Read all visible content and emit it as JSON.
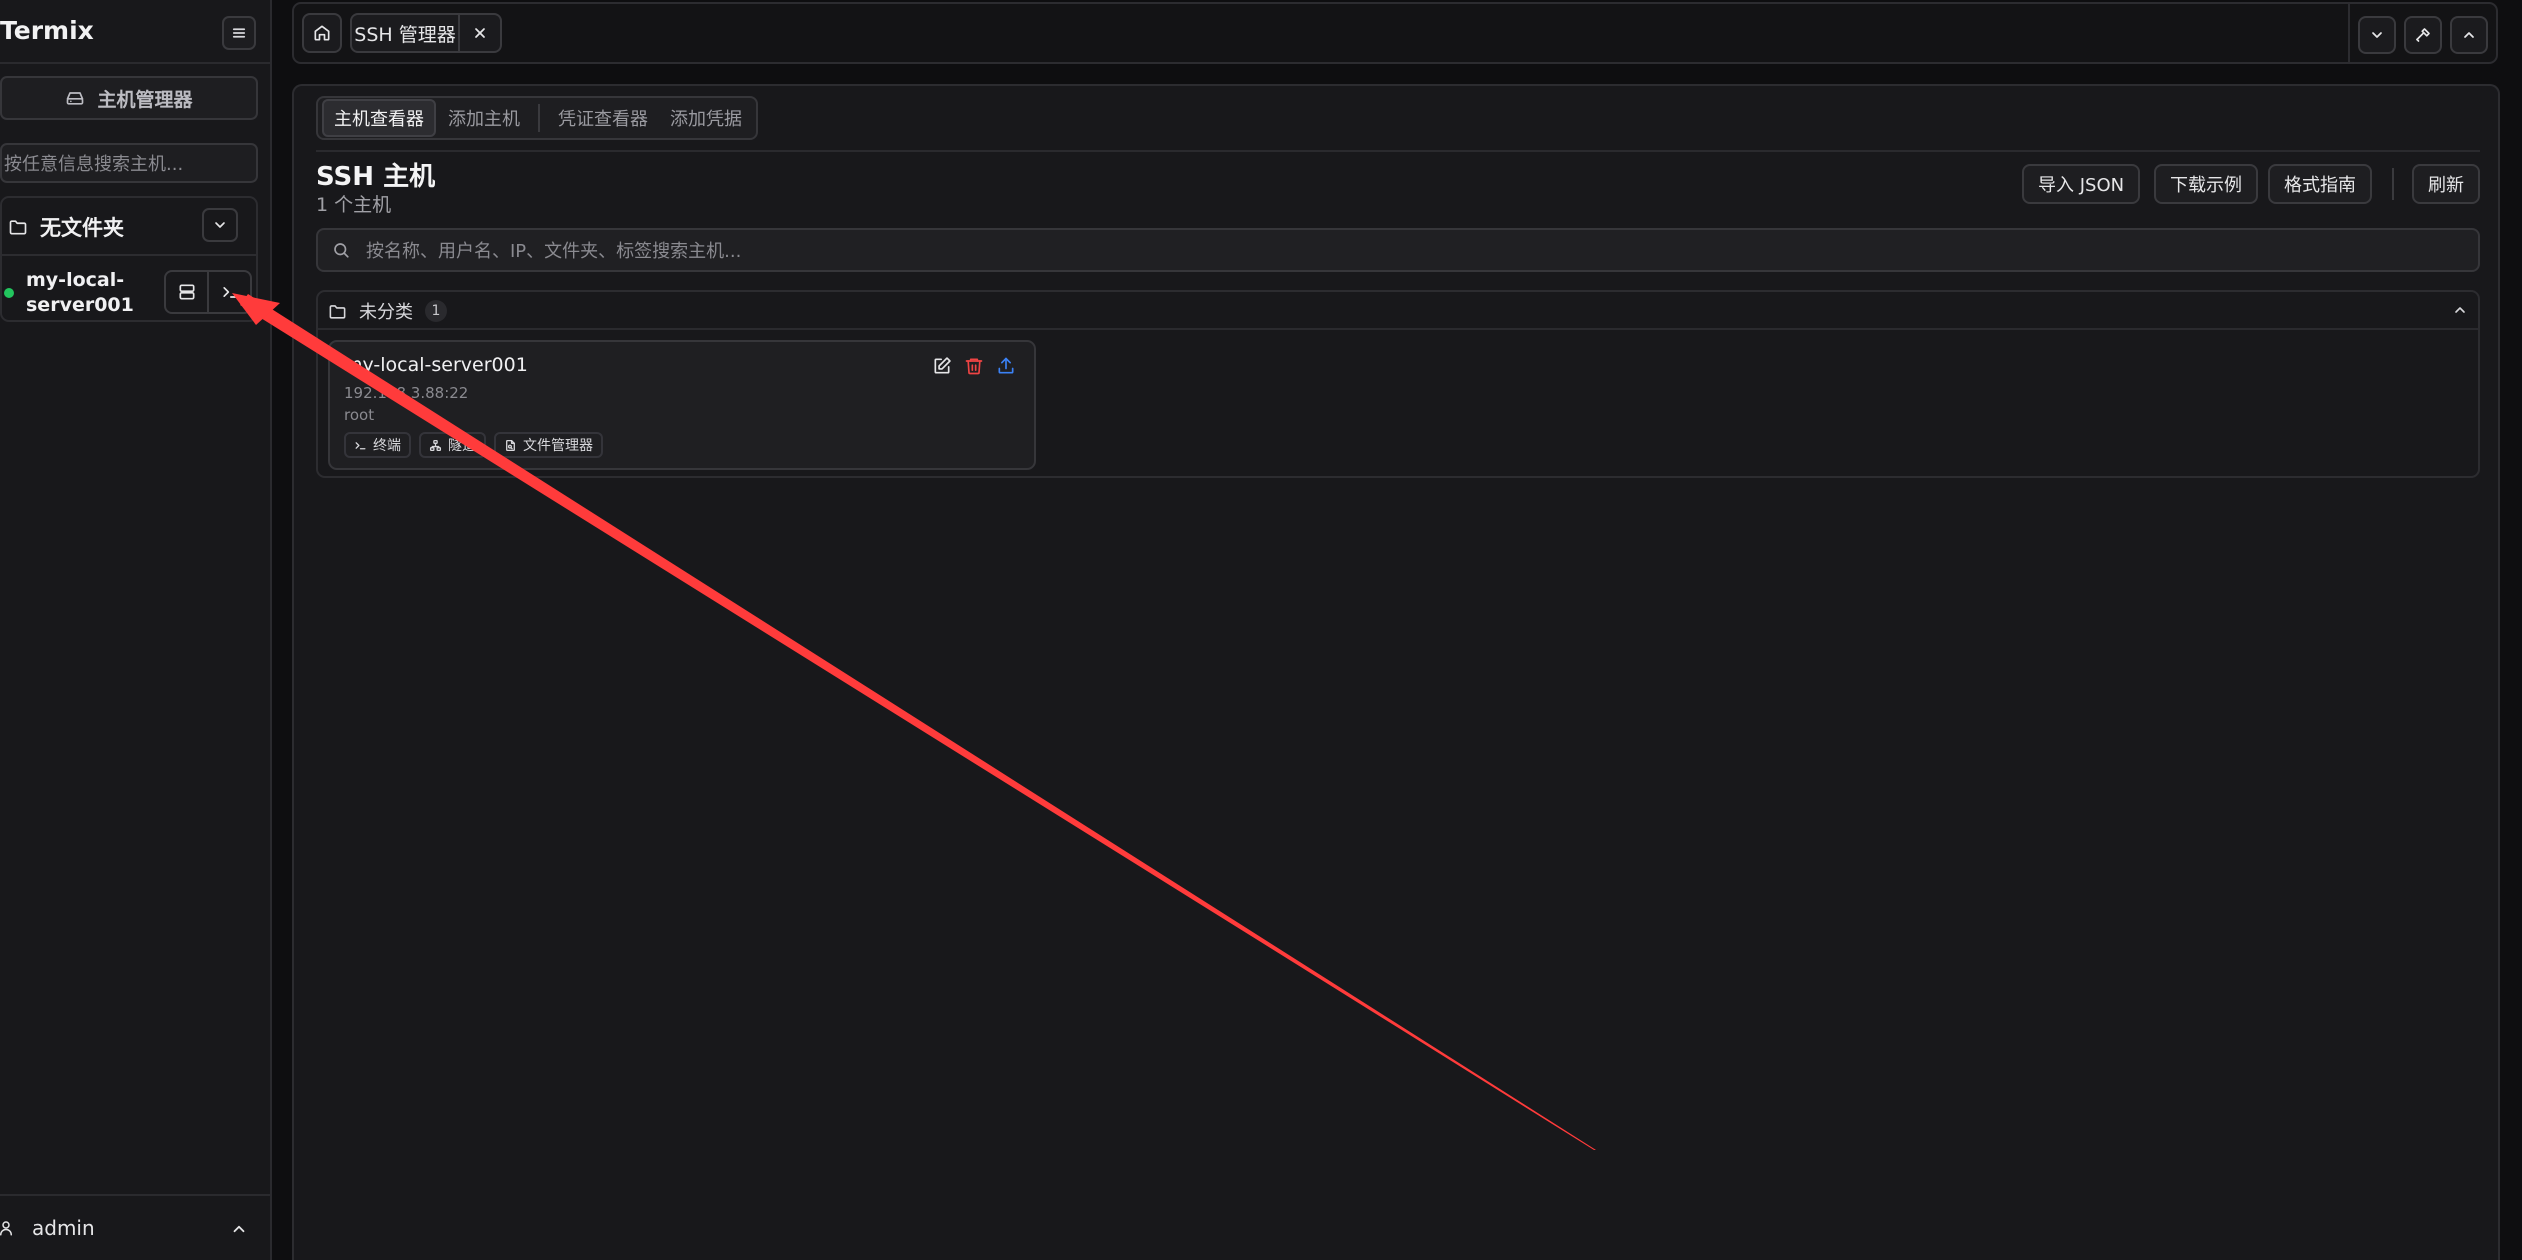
{
  "sidebar": {
    "title": "Termix",
    "host_manager_label": "主机管理器",
    "search_placeholder": "按任意信息搜索主机...",
    "folder": {
      "name": "无文件夹",
      "hosts": [
        {
          "name": "my-local-server001",
          "status": "online"
        }
      ]
    },
    "user": "admin"
  },
  "topbar": {
    "tabs": [
      {
        "label": "SSH 管理器"
      }
    ]
  },
  "main": {
    "tabs": [
      {
        "label": "主机查看器",
        "active": true
      },
      {
        "label": "添加主机",
        "active": false
      },
      {
        "label": "凭证查看器",
        "active": false
      },
      {
        "label": "添加凭据",
        "active": false
      }
    ],
    "title": "SSH 主机",
    "subtitle": "1 个主机",
    "actions": {
      "import_json": "导入 JSON",
      "download_sample": "下载示例",
      "format_guide": "格式指南",
      "refresh": "刷新"
    },
    "search_placeholder": "按名称、用户名、IP、文件夹、标签搜索主机...",
    "group": {
      "name": "未分类",
      "count": "1",
      "hosts": [
        {
          "name": "my-local-server001",
          "address": "192.168.3.88:22",
          "user": "root",
          "tags": [
            "终端",
            "隧道",
            "文件管理器"
          ]
        }
      ]
    }
  },
  "colors": {
    "background": "#0e0e10",
    "panel": "#18181b",
    "border": "#2c2c30",
    "online": "#22c55e",
    "delete": "#ef4444",
    "export": "#3b82f6",
    "annotation_arrow": "#ff3b3b"
  }
}
